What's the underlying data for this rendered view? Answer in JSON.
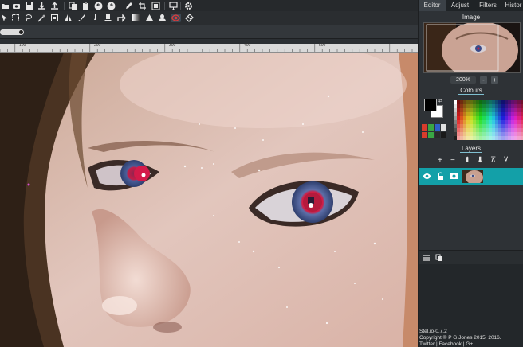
{
  "toolbar_top": {
    "icons": [
      "folder-icon",
      "camera-icon",
      "save-icon",
      "download-icon",
      "upload-icon",
      "copy-icon",
      "paste-icon",
      "undo-icon",
      "redo-icon",
      "pencil-icon",
      "crop-icon",
      "resize-icon",
      "monitor-icon",
      "gear-icon"
    ]
  },
  "toolbar_tools": {
    "icons": [
      "pointer-icon",
      "marquee-icon",
      "lasso-icon",
      "magic-wand-icon",
      "transform-icon",
      "flip-icon",
      "brush-icon",
      "pen-icon",
      "stamp-icon",
      "arrow-icon",
      "gradient-icon",
      "fill-icon",
      "clone-icon",
      "red-eye-icon",
      "eraser-icon"
    ],
    "active": "red-eye-icon"
  },
  "ruler": {
    "labels": [
      "100",
      "200",
      "300",
      "400",
      "500"
    ]
  },
  "panel": {
    "tabs": [
      "Editor",
      "Adjust",
      "Filters",
      "Histor"
    ],
    "active_tab": "Editor",
    "image_title": "Image",
    "zoom": "200%",
    "zoom_minus": "-",
    "zoom_plus": "+",
    "colours_title": "Colours",
    "foreground": "#000000",
    "background": "#ffffff",
    "recent_colours": [
      "#d83c2c",
      "#3aa644",
      "#2f5fc8",
      "#e0e0e0",
      "#d83c2c",
      "#3aa644",
      "#2a2a2a",
      "#1a1a1a"
    ],
    "layers_title": "Layers",
    "layer_actions": [
      "+",
      "−",
      "⬆",
      "⬇",
      "⊼",
      "⊻"
    ],
    "footer": {
      "version": "Stel.io-0.7.2",
      "copyright": "Copyright © P G Jones 2015, 2016.",
      "links": "Twitter | Facebook | G+"
    }
  },
  "colors": {
    "accent": "#13a0a8",
    "panel_bg": "#2e3236",
    "toolbar_bg": "#26292c"
  }
}
